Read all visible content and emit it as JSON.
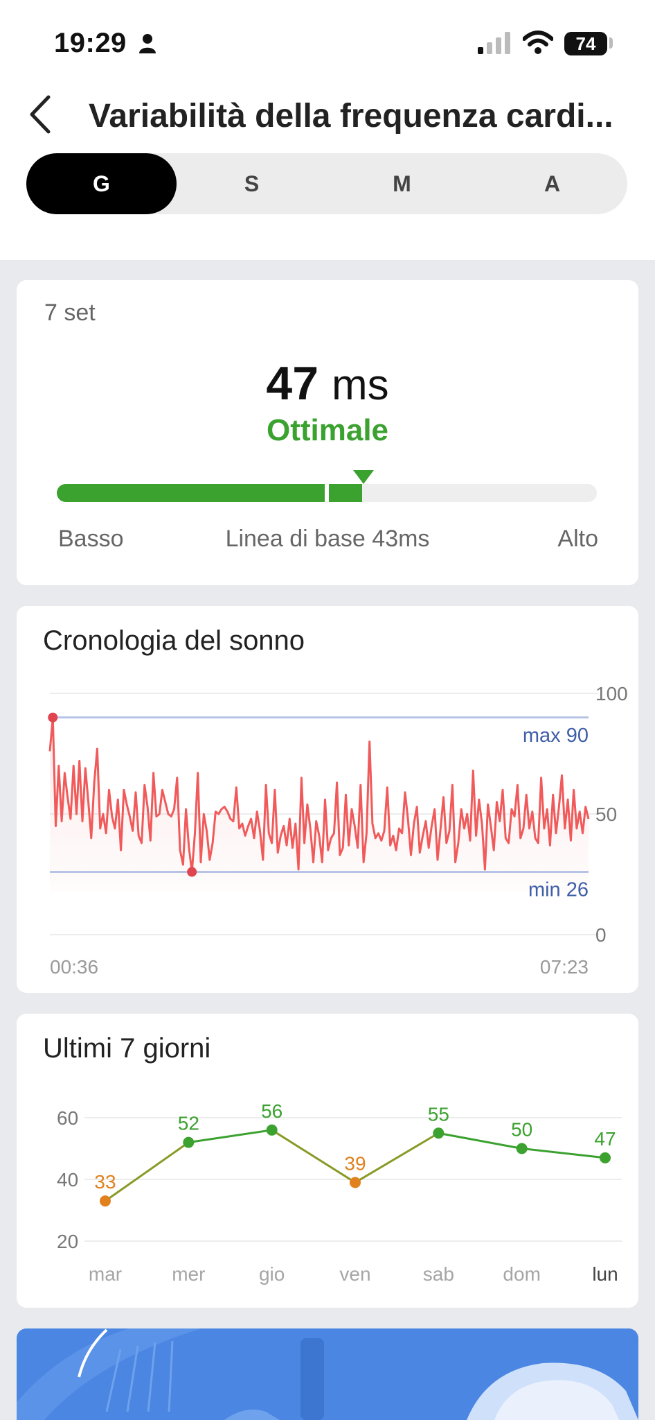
{
  "status_bar": {
    "time": "19:29",
    "battery": "74"
  },
  "header": {
    "title": "Variabilità della frequenza cardi..."
  },
  "tabs": [
    {
      "label": "G",
      "active": true
    },
    {
      "label": "S",
      "active": false
    },
    {
      "label": "M",
      "active": false
    },
    {
      "label": "A",
      "active": false
    }
  ],
  "summary": {
    "date": "7 set",
    "value": "47",
    "unit": "ms",
    "status": "Ottimale",
    "range_fill_fraction": 0.565,
    "marker_fraction": 0.568,
    "low_label": "Basso",
    "baseline_label": "Linea di base 43ms",
    "high_label": "Alto",
    "colors": {
      "optimal": "#3ba12f",
      "track": "#eeeeee"
    }
  },
  "sleep_section": {
    "title": "Cronologia del sonno",
    "max_label": "max 90",
    "min_label": "min 26",
    "start_time": "00:36",
    "end_time": "07:23"
  },
  "week_section": {
    "title": "Ultimi 7 giorni"
  },
  "chart_data": [
    {
      "type": "line",
      "title": "Cronologia del sonno",
      "x_range": [
        "00:36",
        "07:23"
      ],
      "ylim": [
        0,
        100
      ],
      "yticks": [
        "0",
        "50",
        "100"
      ],
      "max": 90,
      "min": 26,
      "series": [
        {
          "values": [
            76,
            90,
            45,
            70,
            47,
            67,
            57,
            48,
            70,
            50,
            72,
            47,
            69,
            55,
            40,
            63,
            77,
            44,
            50,
            42,
            60,
            49,
            44,
            56,
            35,
            60,
            54,
            49,
            43,
            59,
            41,
            38,
            62,
            53,
            39,
            67,
            49,
            50,
            60,
            55,
            50,
            49,
            52,
            65,
            35,
            29,
            52,
            36,
            26,
            42,
            67,
            30,
            50,
            43,
            31,
            38,
            51,
            50,
            52,
            53,
            51,
            48,
            47,
            61,
            44,
            46,
            41,
            45,
            48,
            40,
            51,
            43,
            31,
            62,
            42,
            38,
            60,
            34,
            41,
            45,
            37,
            48,
            36,
            46,
            27,
            65,
            38,
            54,
            44,
            30,
            47,
            41,
            30,
            56,
            35,
            40,
            42,
            63,
            33,
            36,
            58,
            37,
            52,
            45,
            36,
            62,
            30,
            42,
            80,
            46,
            40,
            42,
            39,
            43,
            61,
            37,
            41,
            35,
            44,
            42,
            59,
            48,
            33,
            46,
            53,
            34,
            41,
            47,
            36,
            45,
            52,
            31,
            44,
            57,
            38,
            43,
            62,
            30,
            38,
            52,
            44,
            50,
            39,
            68,
            41,
            56,
            46,
            27,
            54,
            45,
            35,
            55,
            47,
            60,
            40,
            38,
            52,
            49,
            62,
            40,
            44,
            58,
            44,
            51,
            40,
            38,
            65,
            44,
            52,
            37,
            58,
            42,
            53,
            66,
            44,
            56,
            39,
            60,
            44,
            51,
            42,
            53,
            48
          ]
        }
      ]
    },
    {
      "type": "line",
      "title": "Ultimi 7 giorni",
      "categories": [
        "mar",
        "mer",
        "gio",
        "ven",
        "sab",
        "dom",
        "lun"
      ],
      "values": [
        33,
        52,
        56,
        39,
        55,
        50,
        47
      ],
      "ylim": [
        20,
        60
      ],
      "yticks": [
        20,
        40,
        60
      ],
      "colors": {
        "low": "#e0811e",
        "normal": "#3ba12f"
      }
    }
  ]
}
